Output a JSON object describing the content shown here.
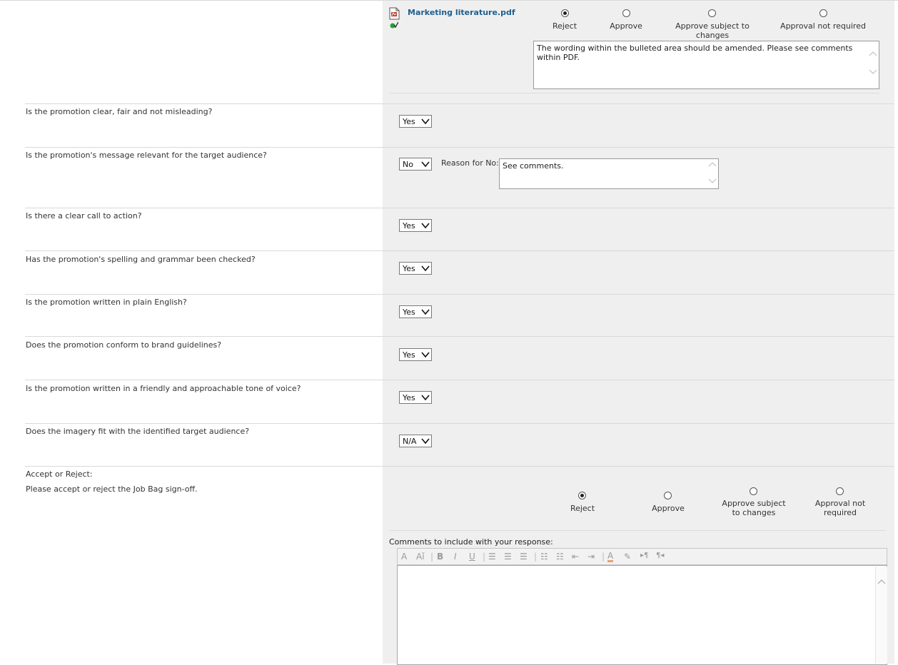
{
  "attachment": {
    "file_name": "Marketing literature.pdf",
    "options": [
      "Reject",
      "Approve",
      "Approve subject to changes",
      "Approval not required"
    ],
    "selected": "Reject",
    "comment": "The wording within the bulleted area should be amended.  Please see comments within PDF."
  },
  "questions": [
    {
      "text": "Is the promotion clear, fair and not misleading?",
      "answer": "Yes"
    },
    {
      "text": "Is the promotion's message relevant for the target audience?",
      "answer": "No",
      "reason_label": "Reason for No:",
      "reason": "See comments."
    },
    {
      "text": "Is there a clear call to action?",
      "answer": "Yes"
    },
    {
      "text": "Has the promotion's spelling and grammar been checked?",
      "answer": "Yes"
    },
    {
      "text": "Is the promotion written in plain English?",
      "answer": "Yes"
    },
    {
      "text": "Does the promotion conform to brand guidelines?",
      "answer": "Yes"
    },
    {
      "text": "Is the promotion written in a friendly and approachable tone of voice?",
      "answer": "Yes"
    },
    {
      "text": "Does the imagery fit with the identified target audience?",
      "answer": "N/A"
    }
  ],
  "signoff": {
    "title": "Accept or Reject:",
    "instruction": "Please accept or reject the Job Bag sign-off.",
    "options": [
      "Reject",
      "Approve",
      "Approve subject to changes",
      "Approval not required"
    ],
    "selected": "Reject",
    "comments_label": "Comments to include with your response:",
    "comments_value": ""
  },
  "icons": {
    "pdf": "pdf-file-icon",
    "status": "checked-status-icon"
  }
}
